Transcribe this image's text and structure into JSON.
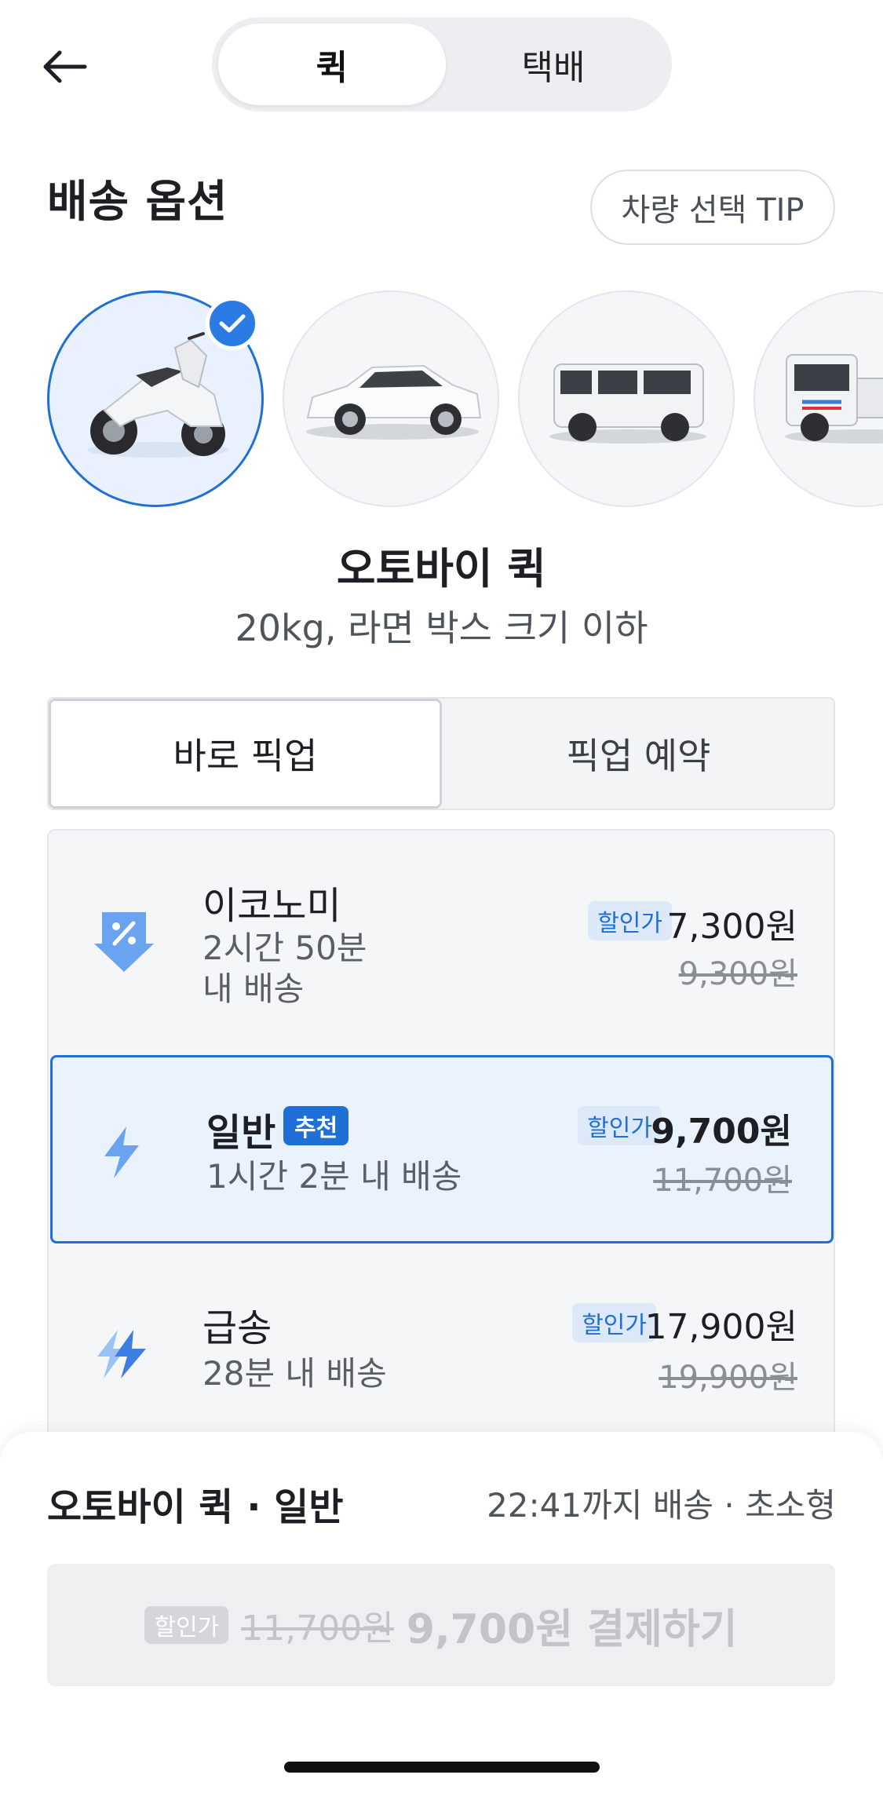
{
  "header": {
    "back_icon": "arrow-left-icon",
    "segments": [
      {
        "label": "퀵",
        "selected": true
      },
      {
        "label": "택배",
        "selected": false
      }
    ]
  },
  "options": {
    "title": "배송 옵션",
    "tip_label": "차량 선택 TIP"
  },
  "vehicles": [
    {
      "icon": "motorcycle-icon",
      "selected": true
    },
    {
      "icon": "car-icon",
      "selected": false
    },
    {
      "icon": "van-icon",
      "selected": false
    },
    {
      "icon": "truck-icon",
      "selected": false
    }
  ],
  "selected_vehicle": {
    "name": "오토바이 퀵",
    "desc": "20kg, 라면 박스 크기 이하"
  },
  "pickup_tabs": [
    {
      "label": "바로 픽업",
      "selected": true
    },
    {
      "label": "픽업 예약",
      "selected": false
    }
  ],
  "tiers": [
    {
      "icon": "discount-arrow-icon",
      "name": "이코노미",
      "sub_line1": "2시간 50분",
      "sub_line2": "내 배송",
      "discount_label": "할인가",
      "price": "7,300원",
      "original_price": "9,300원",
      "selected": false
    },
    {
      "icon": "lightning-icon",
      "name": "일반",
      "badge": "추천",
      "sub_line1": "1시간 2분 내 배송",
      "discount_label": "할인가",
      "price": "9,700원",
      "original_price": "11,700원",
      "selected": true
    },
    {
      "icon": "double-lightning-icon",
      "name": "급송",
      "sub_line1": "28분 내 배송",
      "discount_label": "할인가",
      "price": "17,900원",
      "original_price": "19,900원",
      "selected": false
    }
  ],
  "summary": {
    "title": "오토바이 퀵 · 일반",
    "info": "22:41까지 배송 · 초소형"
  },
  "pay_button": {
    "discount_label": "할인가",
    "original_price": "11,700원",
    "label": "9,700원 결제하기",
    "enabled": false
  },
  "colors": {
    "accent": "#1f6fd6",
    "selected_bg": "#e9f2fd",
    "muted_text": "#8a8e95"
  }
}
